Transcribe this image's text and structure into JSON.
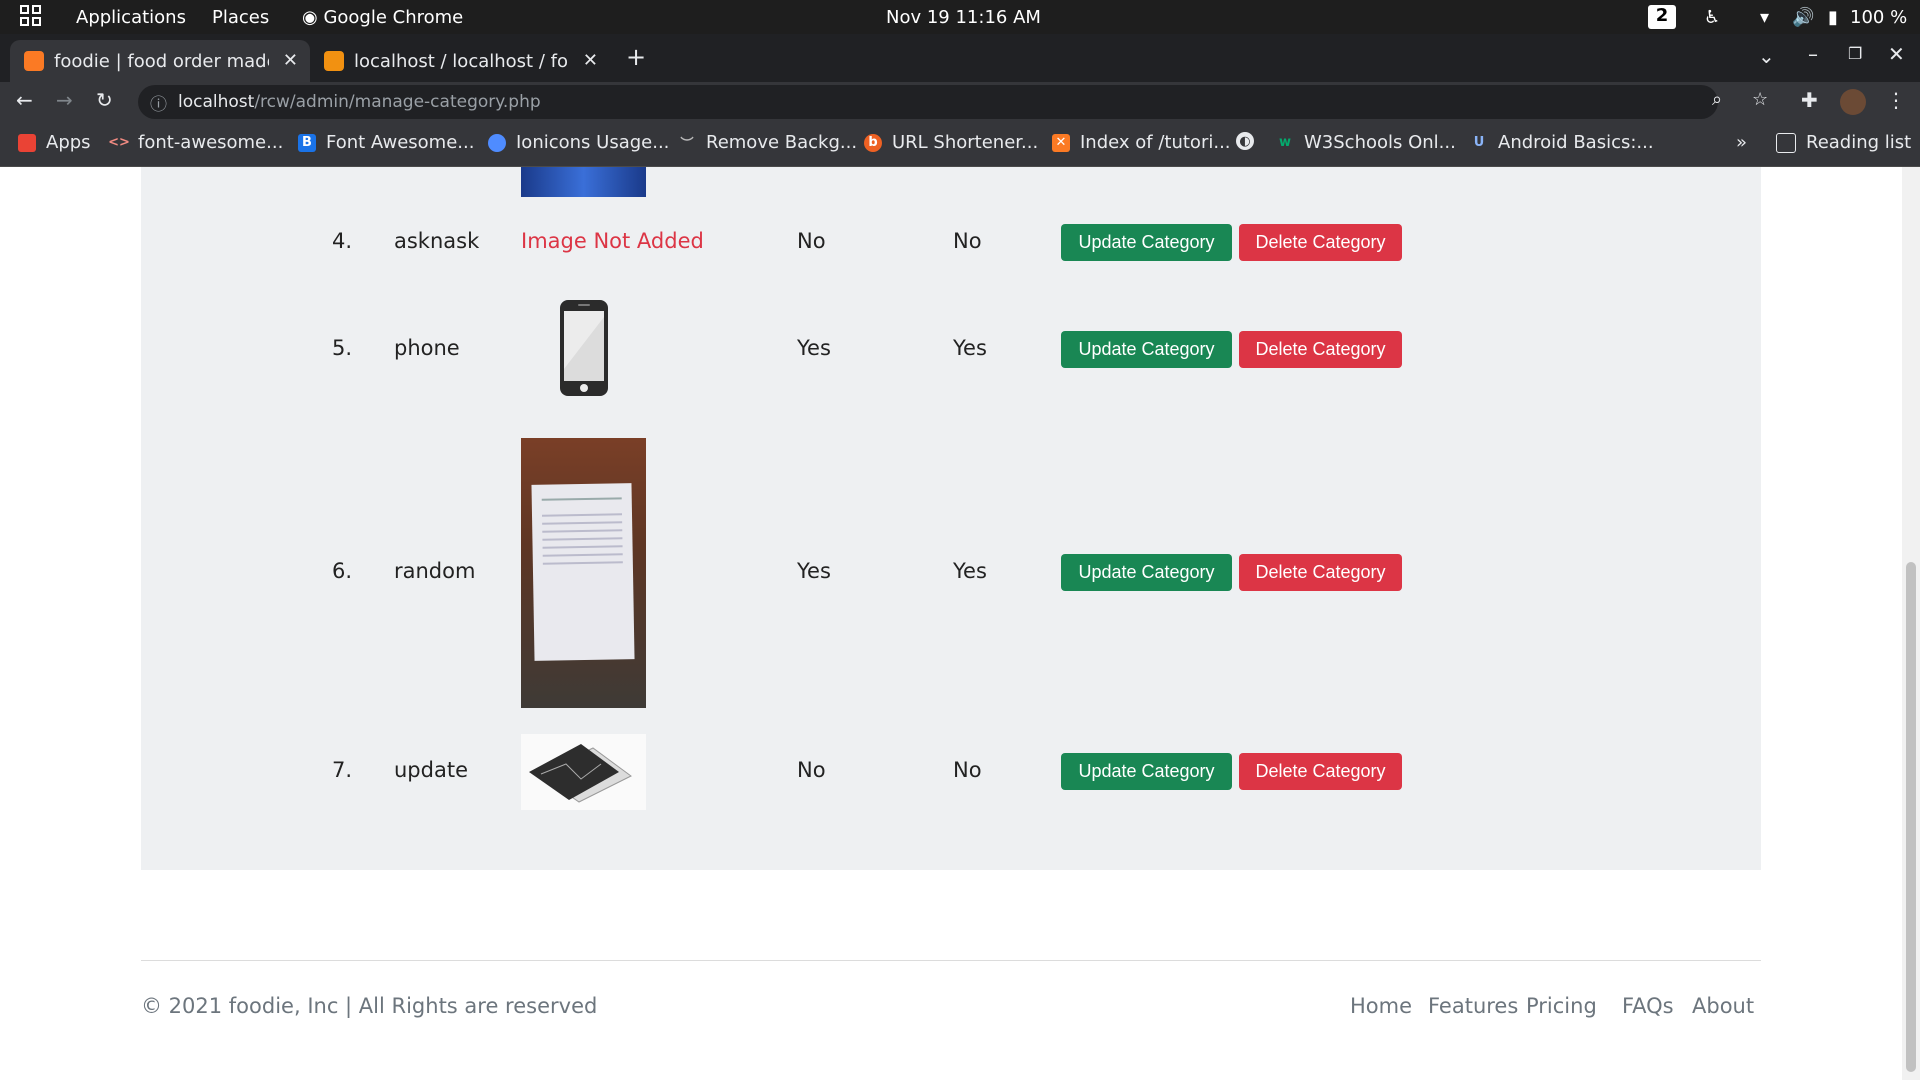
{
  "system_bar": {
    "applications": "Applications",
    "places": "Places",
    "chrome": "Google Chrome",
    "datetime": "Nov 19  11:16 AM",
    "workspace": "2",
    "battery": "100 %"
  },
  "tabs": [
    {
      "title": "foodie | food order made e",
      "active": true
    },
    {
      "title": "localhost / localhost / food",
      "active": false
    }
  ],
  "address": {
    "host": "localhost",
    "path": "/rcw/admin/manage-category.php"
  },
  "bookmarks": [
    "Apps",
    "font-awesome...",
    "Font Awesome...",
    "Ionicons Usage...",
    "Remove Backg...",
    "URL Shortener...",
    "Index of /tutori...",
    "W3Schools Onl...",
    "Android Basics:..."
  ],
  "reading_list": "Reading list",
  "categories": [
    {
      "sn": "4.",
      "title": "asknask",
      "image": "Image Not Added",
      "featured": "No",
      "active": "No"
    },
    {
      "sn": "5.",
      "title": "phone",
      "image": "phone-image",
      "featured": "Yes",
      "active": "Yes"
    },
    {
      "sn": "6.",
      "title": "random",
      "image": "document-photo",
      "featured": "Yes",
      "active": "Yes"
    },
    {
      "sn": "7.",
      "title": "update",
      "image": "broken-phones-photo",
      "featured": "No",
      "active": "No"
    }
  ],
  "buttons": {
    "update": "Update Category",
    "delete": "Delete Category"
  },
  "footer": {
    "copyright": "© 2021 foodie, Inc | All Rights are reserved",
    "links": [
      "Home",
      "Features",
      "Pricing",
      "FAQs",
      "About"
    ]
  }
}
